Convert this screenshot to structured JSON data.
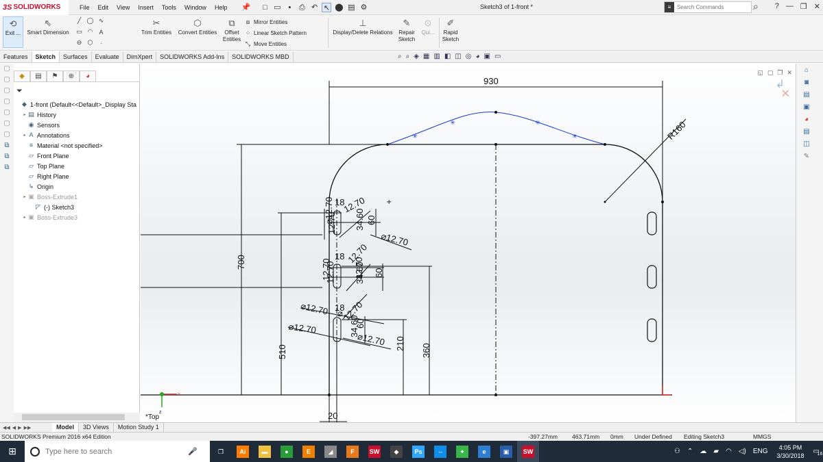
{
  "app": {
    "logo_ds": "3S",
    "logo_text": "SOLIDWORKS",
    "menus": [
      "File",
      "Edit",
      "View",
      "Insert",
      "Tools",
      "Window",
      "Help"
    ],
    "document_title": "Sketch3 of 1-front *",
    "search_placeholder": "Search Commands",
    "help_glyph": "?"
  },
  "command_manager": {
    "exit_label": "Exit ...",
    "smart_dimension": "Smart Dimension",
    "trim_entities": "Trim Entities",
    "convert_entities": "Convert Entities",
    "offset_entities_line1": "Offset",
    "offset_entities_line2": "Entities",
    "mirror_entities": "Mirror Entities",
    "linear_sketch_pattern": "Linear Sketch Pattern",
    "move_entities": "Move Entities",
    "display_delete_relations": "Display/Delete Relations",
    "repair_sketch_line1": "Repair",
    "repair_sketch_line2": "Sketch",
    "quick_snaps": "Qui...",
    "rapid_sketch_line1": "Rapid",
    "rapid_sketch_line2": "Sketch"
  },
  "tabs": [
    "Features",
    "Sketch",
    "Surfaces",
    "Evaluate",
    "DimXpert",
    "SOLIDWORKS Add-Ins",
    "SOLIDWORKS MBD"
  ],
  "active_tab": "Sketch",
  "feature_tree": [
    {
      "label": "1-front  (Default<<Default>_Display Sta",
      "icon": "part-icon",
      "indent": 0,
      "twisty": false,
      "dim": false
    },
    {
      "label": "History",
      "icon": "history-icon",
      "indent": 1,
      "twisty": true,
      "dim": false
    },
    {
      "label": "Sensors",
      "icon": "sensors-icon",
      "indent": 1,
      "twisty": false,
      "dim": false
    },
    {
      "label": "Annotations",
      "icon": "annotations-icon",
      "indent": 1,
      "twisty": true,
      "dim": false
    },
    {
      "label": "Material <not specified>",
      "icon": "material-icon",
      "indent": 1,
      "twisty": false,
      "dim": false
    },
    {
      "label": "Front Plane",
      "icon": "plane-icon",
      "indent": 1,
      "twisty": false,
      "dim": false
    },
    {
      "label": "Top Plane",
      "icon": "plane-icon",
      "indent": 1,
      "twisty": false,
      "dim": false
    },
    {
      "label": "Right Plane",
      "icon": "plane-icon",
      "indent": 1,
      "twisty": false,
      "dim": false
    },
    {
      "label": "Origin",
      "icon": "origin-icon",
      "indent": 1,
      "twisty": false,
      "dim": false
    },
    {
      "label": "Boss-Extrude1",
      "icon": "extrude-icon",
      "indent": 1,
      "twisty": true,
      "dim": true
    },
    {
      "label": "(-) Sketch3",
      "icon": "sketch-icon",
      "indent": 2,
      "twisty": false,
      "dim": false
    },
    {
      "label": "Boss-Extrude3",
      "icon": "extrude-icon",
      "indent": 1,
      "twisty": true,
      "dim": true
    }
  ],
  "graphics": {
    "view_label": "*Top",
    "dims": {
      "d930": "930",
      "r160": "R160",
      "d700": "700",
      "d510": "510",
      "d210": "210",
      "d360": "360",
      "d20": "20",
      "d18": "18",
      "d60": "60",
      "d34_60": "34.60",
      "d12_70": "12.70",
      "dia12_70": "⌀12.70",
      "dia_prefix": "⌀"
    }
  },
  "bottom_tabs": [
    "Model",
    "3D Views",
    "Motion Study 1"
  ],
  "active_bottom_tab": "Model",
  "status": {
    "edition": "SOLIDWORKS Premium 2016 x64 Edition",
    "x": "-397.27mm",
    "y": "463.71mm",
    "z": "0mm",
    "state": "Under Defined",
    "editing": "Editing Sketch3",
    "units": "MMGS"
  },
  "taskbar": {
    "search_placeholder": "Type here to search",
    "apps": [
      "task-view-icon",
      "illustrator-icon",
      "file-explorer-icon",
      "chrome-icon",
      "eclipse-icon",
      "app-icon",
      "folder-app-icon",
      "solidworks-2016-icon",
      "inkscape-icon",
      "photoshop-icon",
      "teamviewer-icon",
      "paint-app-icon",
      "edge-icon",
      "cmd-icon",
      "solidworks-icon"
    ],
    "app_glyphs": [
      "❐",
      "Ai",
      "▬",
      "●",
      "E",
      "◢",
      "F",
      "SW",
      "◆",
      "Ps",
      "⇔",
      "✦",
      "e",
      "▣",
      "SW"
    ],
    "app_colors": [
      "#1f2b38",
      "#ff7c00",
      "#f0c040",
      "#2a9d3a",
      "#f08000",
      "#888888",
      "#e87a1e",
      "#c8102e",
      "#444444",
      "#31a8ff",
      "#0e8ee9",
      "#39b54a",
      "#2d7dd2",
      "#2a5da8",
      "#c8102e"
    ],
    "active_app_index": 14,
    "language": "ENG",
    "time": "4:05 PM",
    "date": "3/30/2018",
    "notifications": "16"
  }
}
